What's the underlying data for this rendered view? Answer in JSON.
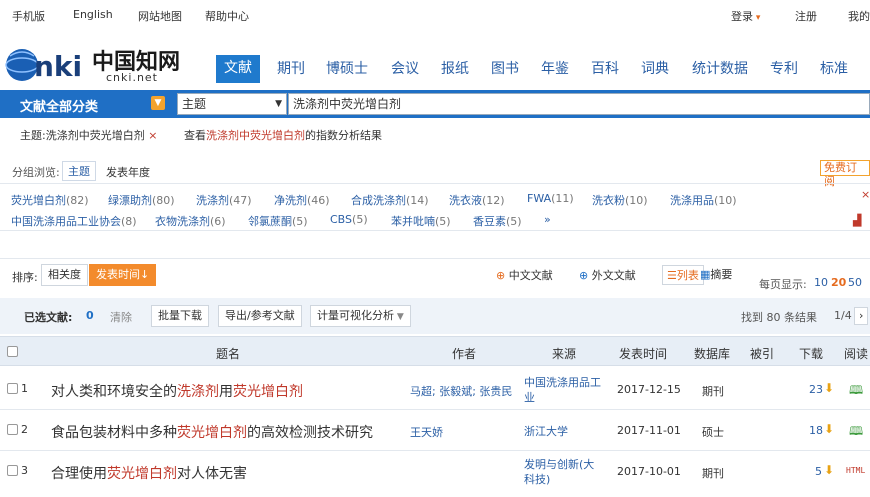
{
  "topbar": {
    "mobile": "手机版",
    "english": "English",
    "sitemap": "网站地图",
    "help": "帮助中心",
    "login": "登录",
    "register": "注册",
    "mine": "我的"
  },
  "logo": {
    "zh": "中国知网",
    "en": "cnki.net",
    "brand": "CNKI"
  },
  "tabs": [
    "文献",
    "期刊",
    "博硕士",
    "会议",
    "报纸",
    "图书",
    "年鉴",
    "百科",
    "词典",
    "统计数据",
    "专利",
    "标准"
  ],
  "search": {
    "category": "文献全部分类",
    "field": "主题",
    "query": "洗涤剂中荧光增白剂"
  },
  "crumbs": {
    "topic": "主题:洗涤剂中荧光增白剂",
    "view_prefix": "查看",
    "view_term": "洗涤剂中荧光增白剂",
    "view_suffix": "的指数分析结果"
  },
  "group": {
    "label": "分组浏览:",
    "topic": "主题",
    "year": "发表年度",
    "free": "免费订阅"
  },
  "facets": [
    {
      "name": "荧光增白剂",
      "count": "(82)"
    },
    {
      "name": "绿漂助剂",
      "count": "(80)"
    },
    {
      "name": "洗涤剂",
      "count": "(47)"
    },
    {
      "name": "净洗剂",
      "count": "(46)"
    },
    {
      "name": "合成洗涤剂",
      "count": "(14)"
    },
    {
      "name": "洗衣液",
      "count": "(12)"
    },
    {
      "name": "FWA",
      "count": "(11)"
    },
    {
      "name": "洗衣粉",
      "count": "(10)"
    },
    {
      "name": "洗涤用品",
      "count": "(10)"
    },
    {
      "name": "中国洗涤用品工业协会",
      "count": "(8)"
    },
    {
      "name": "衣物洗涤剂",
      "count": "(6)"
    },
    {
      "name": "邻氯蔗酮",
      "count": "(5)"
    },
    {
      "name": "CBS",
      "count": "(5)"
    },
    {
      "name": "苯并吡喃",
      "count": "(5)"
    },
    {
      "name": "香豆素",
      "count": "(5)"
    }
  ],
  "facet_more": "»",
  "sort": {
    "label": "排序:",
    "relevance": "相关度",
    "date": "发表时间",
    "zh": "中文文献",
    "foreign": "外文文献",
    "list": "列表",
    "abstract": "摘要",
    "perpage": "每页显示:",
    "p10": "10",
    "p20": "20",
    "p50": "50"
  },
  "actions": {
    "selected": "已选文献:",
    "selected_count": "0",
    "clear": "清除",
    "batch": "批量下载",
    "export": "导出/参考文献",
    "viz": "计量可视化分析",
    "found": "找到 80 条结果",
    "page": "1/4"
  },
  "columns": {
    "title": "题名",
    "author": "作者",
    "source": "来源",
    "date": "发表时间",
    "db": "数据库",
    "cited": "被引",
    "download": "下载",
    "read": "阅读"
  },
  "rows": [
    {
      "no": "1",
      "t1": "对人类和环境安全的",
      "t2": "洗涤剂",
      "t3": "用",
      "t4": "荧光增白剂",
      "t5": "",
      "author": "马超; 张毅斌; 张贵民",
      "source": "中国洗涤用品工业",
      "date": "2017-12-15",
      "db": "期刊",
      "downloads": "23"
    },
    {
      "no": "2",
      "t1": "食品包装材料中多种",
      "t2": "荧光增白剂",
      "t3": "的高效检测技术研究",
      "t4": "",
      "t5": "",
      "author": "王天娇",
      "source": "浙江大学",
      "date": "2017-11-01",
      "db": "硕士",
      "downloads": "18"
    },
    {
      "no": "3",
      "t1": "合理使用",
      "t2": "荧光增白剂",
      "t3": "对人体无害",
      "t4": "",
      "t5": "",
      "author": "",
      "source": "发明与创新(大科技)",
      "date": "2017-10-01",
      "db": "期刊",
      "downloads": "5"
    }
  ],
  "html_badge": "HTML"
}
